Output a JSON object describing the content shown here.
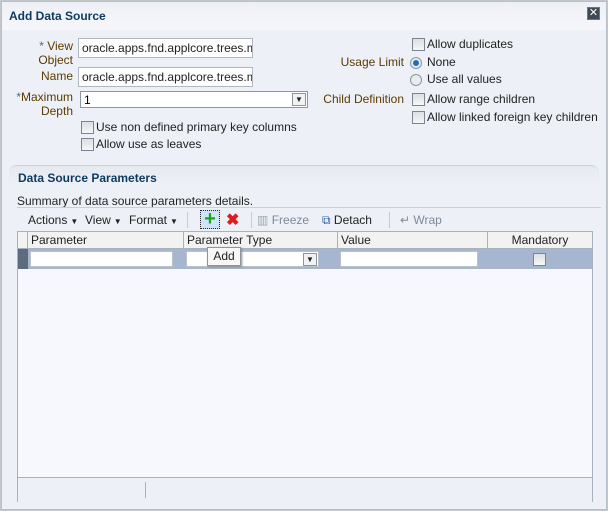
{
  "dialog": {
    "title": "Add Data Source",
    "close_icon": "close-icon"
  },
  "form": {
    "view_object": {
      "required": "*",
      "label_line1": "View",
      "label_line2": "Object",
      "value": "oracle.apps.fnd.applcore.trees.moc"
    },
    "name": {
      "label": "Name",
      "value": "oracle.apps.fnd.applcore.trees.moc"
    },
    "maximum_depth": {
      "required": "*",
      "label_line1": "Maximum",
      "label_line2": "Depth",
      "value": "1"
    },
    "use_non_defined_pk": {
      "label": "Use non defined primary key columns",
      "checked": false
    },
    "allow_use_as_leaves": {
      "label": "Allow use as leaves",
      "checked": false
    },
    "allow_duplicates": {
      "label": "Allow duplicates",
      "checked": false
    },
    "usage_limit": {
      "label": "Usage Limit",
      "options": [
        "None",
        "Use all values"
      ],
      "selected": "None"
    },
    "child_definition": {
      "label": "Child Definition",
      "allow_range_children": "Allow range children",
      "allow_linked_fk_children": "Allow linked foreign key children"
    }
  },
  "parameters": {
    "section_title": "Data Source Parameters",
    "summary": "Summary of data source parameters details.",
    "toolbar": {
      "actions": "Actions",
      "view": "View",
      "format": "Format",
      "freeze": "Freeze",
      "detach": "Detach",
      "wrap": "Wrap",
      "add_tooltip": "Add"
    },
    "columns": [
      "Parameter",
      "Parameter Type",
      "Value",
      "Mandatory"
    ],
    "rows": [
      {
        "parameter": "",
        "parameter_type": "",
        "value": "",
        "mandatory": false
      }
    ]
  }
}
